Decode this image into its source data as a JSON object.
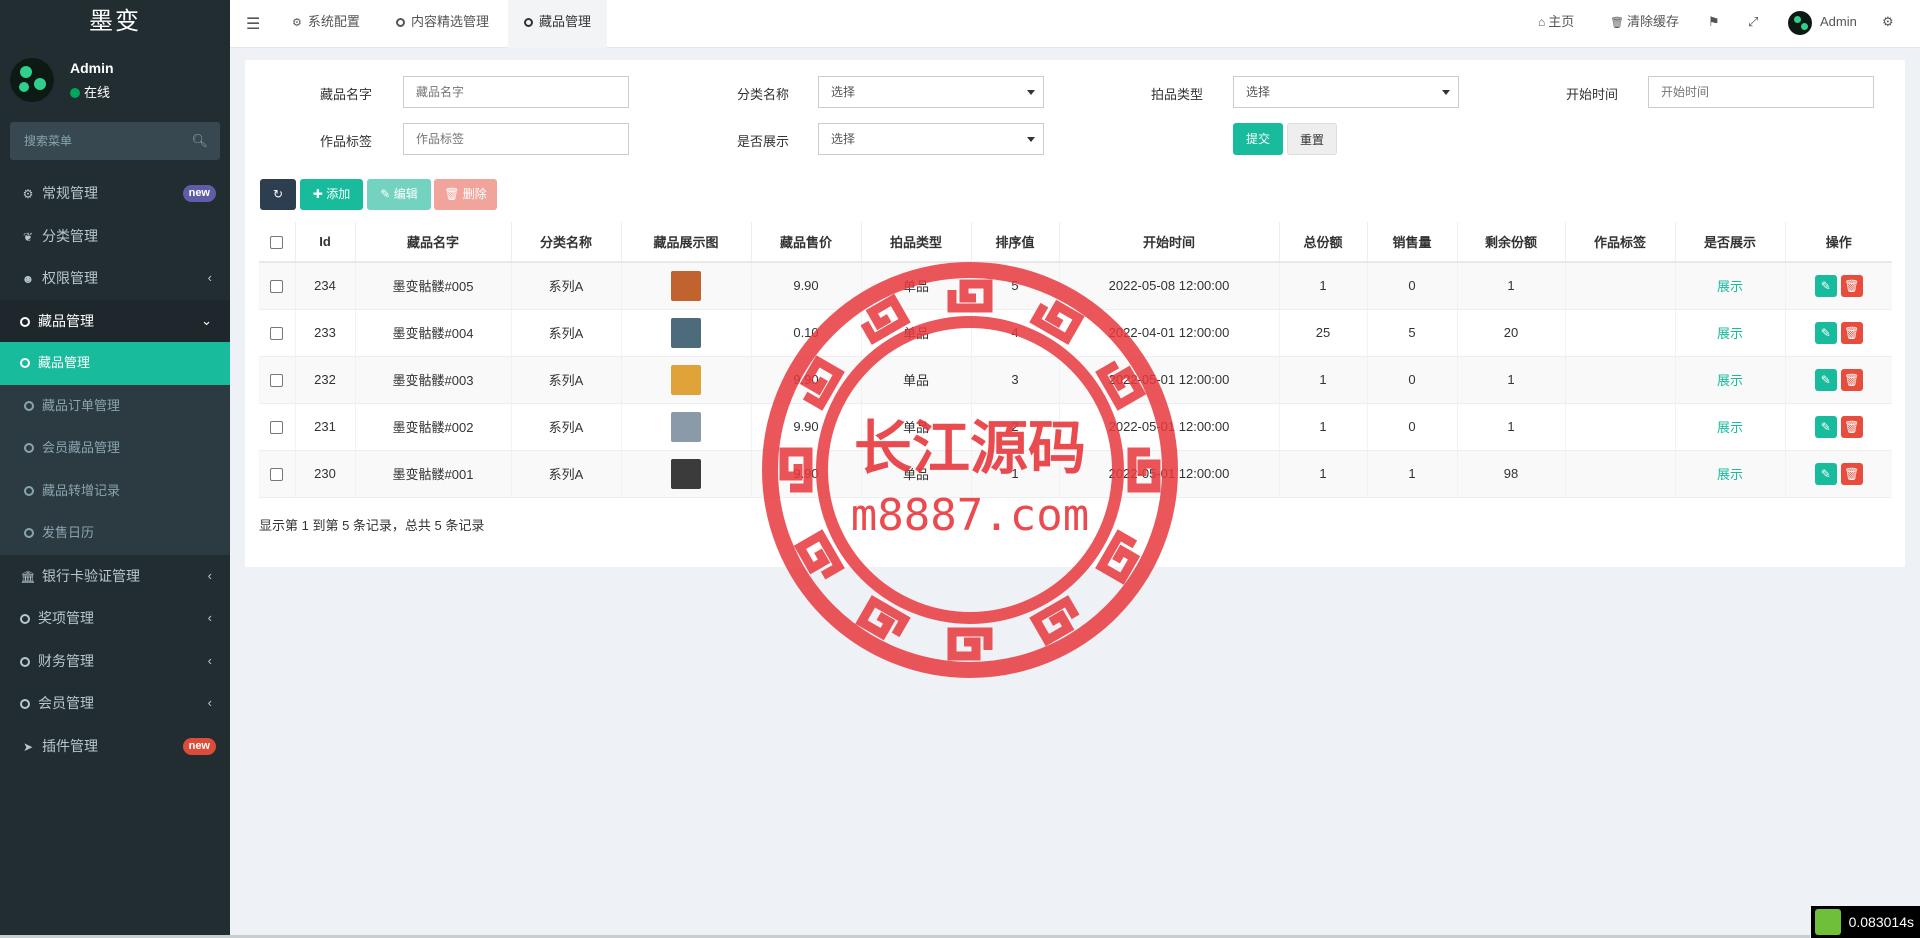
{
  "app": {
    "brand": "墨变"
  },
  "user": {
    "name": "Admin",
    "status": "在线"
  },
  "sidebar": {
    "search_placeholder": "搜索菜单",
    "items": [
      {
        "label": "常规管理",
        "icon": "gears-icon",
        "badge": "new"
      },
      {
        "label": "分类管理",
        "icon": "leaf-icon"
      },
      {
        "label": "权限管理",
        "icon": "users-icon"
      },
      {
        "label": "藏品管理",
        "icon": "circle-icon"
      },
      {
        "label": "银行卡验证管理",
        "icon": "bank-icon"
      },
      {
        "label": "奖项管理",
        "icon": "circle-icon"
      },
      {
        "label": "财务管理",
        "icon": "circle-icon"
      },
      {
        "label": "会员管理",
        "icon": "circle-icon"
      },
      {
        "label": "插件管理",
        "icon": "rocket-icon",
        "badge": "new"
      }
    ],
    "sub_items": [
      {
        "label": "藏品管理",
        "active": true
      },
      {
        "label": "藏品订单管理"
      },
      {
        "label": "会员藏品管理"
      },
      {
        "label": "藏品转增记录"
      },
      {
        "label": "发售日历"
      }
    ]
  },
  "topnav": {
    "tabs": [
      {
        "label": "系统配置",
        "icon": "gear-icon"
      },
      {
        "label": "内容精选管理",
        "icon": "circle-icon"
      },
      {
        "label": "藏品管理",
        "icon": "circle-icon",
        "active": true
      }
    ],
    "home": "主页",
    "clear_cache": "清除缓存",
    "admin": "Admin"
  },
  "filters": {
    "name_label": "藏品名字",
    "name_placeholder": "藏品名字",
    "category_label": "分类名称",
    "category_value": "选择",
    "auction_label": "拍品类型",
    "auction_value": "选择",
    "start_label": "开始时间",
    "start_placeholder": "开始时间",
    "tag_label": "作品标签",
    "tag_placeholder": "作品标签",
    "display_label": "是否展示",
    "display_value": "选择",
    "submit": "提交",
    "reset": "重置"
  },
  "toolbar": {
    "add": "添加",
    "edit": "编辑",
    "delete": "删除"
  },
  "table": {
    "columns": [
      "Id",
      "藏品名字",
      "分类名称",
      "藏品展示图",
      "藏品售价",
      "拍品类型",
      "排序值",
      "开始时间",
      "总份额",
      "销售量",
      "剩余份额",
      "作品标签",
      "是否展示",
      "操作"
    ],
    "rows": [
      {
        "id": "234",
        "name": "墨变骷髅#005",
        "category": "系列A",
        "price": "9.90",
        "type": "单品",
        "sort": "5",
        "start": "2022-05-08 12:00:00",
        "total": "1",
        "sold": "0",
        "left": "1",
        "tag": "",
        "display": "展示",
        "thumb_color": "#c0632e"
      },
      {
        "id": "233",
        "name": "墨变骷髅#004",
        "category": "系列A",
        "price": "0.10",
        "type": "单品",
        "sort": "4",
        "start": "2022-04-01 12:00:00",
        "total": "25",
        "sold": "5",
        "left": "20",
        "tag": "",
        "display": "展示",
        "thumb_color": "#4d6b7a"
      },
      {
        "id": "232",
        "name": "墨变骷髅#003",
        "category": "系列A",
        "price": "9.90",
        "type": "单品",
        "sort": "3",
        "start": "2022-05-01 12:00:00",
        "total": "1",
        "sold": "0",
        "left": "1",
        "tag": "",
        "display": "展示",
        "thumb_color": "#e0a33a"
      },
      {
        "id": "231",
        "name": "墨变骷髅#002",
        "category": "系列A",
        "price": "9.90",
        "type": "单品",
        "sort": "2",
        "start": "2022-05-01 12:00:00",
        "total": "1",
        "sold": "0",
        "left": "1",
        "tag": "",
        "display": "展示",
        "thumb_color": "#8a9aa8"
      },
      {
        "id": "230",
        "name": "墨变骷髅#001",
        "category": "系列A",
        "price": "9.90",
        "type": "单品",
        "sort": "1",
        "start": "2022-05-01 12:00:00",
        "total": "1",
        "sold": "1",
        "left": "98",
        "tag": "",
        "display": "展示",
        "thumb_color": "#3b3b3b"
      }
    ]
  },
  "pager": {
    "text": "显示第 1 到第 5 条记录，总共 5 条记录"
  },
  "watermark": {
    "line1": "长江源码",
    "line2": "m8887.com"
  },
  "perf": {
    "time": "0.083014s"
  }
}
